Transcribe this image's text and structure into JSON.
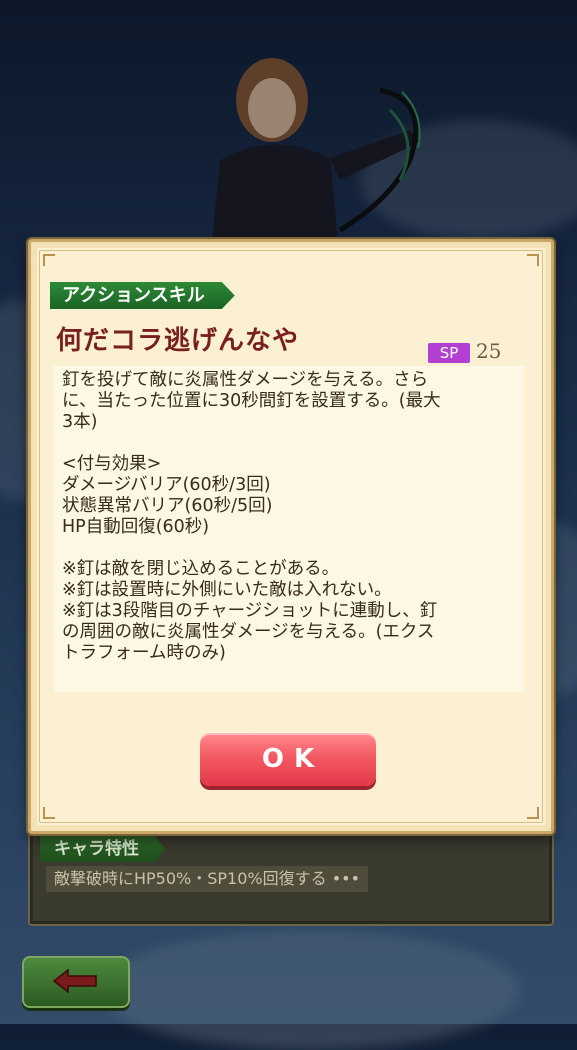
{
  "dialog": {
    "tag_label": "アクションスキル",
    "skill_name": "何だコラ逃げんなや",
    "sp_label": "SP",
    "sp_value": "25",
    "description_lines": [
      "釘を投げて敵に炎属性ダメージを与える。さら",
      "に、当たった位置に30秒間釘を設置する。(最大",
      "3本)",
      "",
      "<付与効果>",
      "ダメージバリア(60秒/3回)",
      "状態異常バリア(60秒/5回)",
      "HP自動回復(60秒)",
      "",
      "※釘は敵を閉じ込めることがある。",
      "※釘は設置時に外側にいた敵は入れない。",
      "※釘は3段階目のチャージショットに連動し、釘",
      "の周囲の敵に炎属性ダメージを与える。(エクス",
      "トラフォーム時のみ)"
    ],
    "ok_label": "OK"
  },
  "background_panel": {
    "trait_tab_label": "キャラ特性",
    "trait_text": "敵撃破時にHP50%・SP10%回復する •••"
  },
  "icons": {
    "back": "left-arrow-icon"
  },
  "colors": {
    "skill_name": "#7a1f1f",
    "sp_badge": "#b23fd1",
    "ok_button": "#f45a63",
    "tag_green": "#2d8a36"
  }
}
